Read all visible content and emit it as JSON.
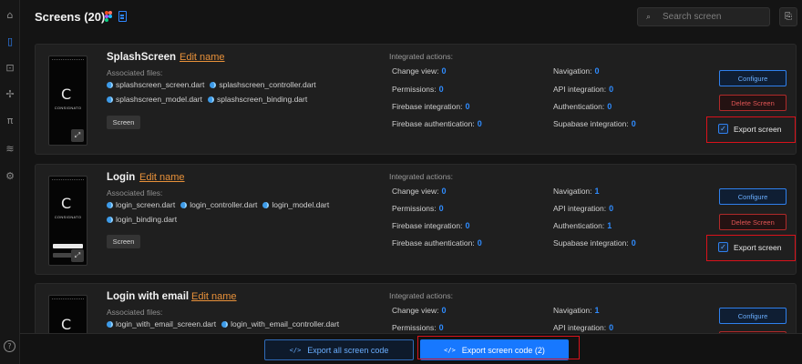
{
  "header": {
    "title": "Screens (20)",
    "search_placeholder": "Search screen"
  },
  "sidebar": {
    "items": [
      {
        "icon": "home-icon",
        "glyph": "⌂"
      },
      {
        "icon": "phone-icon",
        "glyph": "▯"
      },
      {
        "icon": "code-box-icon",
        "glyph": "⊡"
      },
      {
        "icon": "components-icon",
        "glyph": "✢"
      },
      {
        "icon": "pi-icon",
        "glyph": "π"
      },
      {
        "icon": "wifi-icon",
        "glyph": "≋"
      },
      {
        "icon": "settings-icon",
        "glyph": "⚙"
      },
      {
        "icon": "help-icon",
        "glyph": "?"
      }
    ]
  },
  "labels": {
    "edit_name": "Edit name",
    "associated_files": "Associated files:",
    "integrated_actions": "Integrated actions:",
    "screen_tag": "Screen",
    "configure": "Configure",
    "delete_screen": "Delete Screen",
    "export_screen": "Export screen",
    "thumb_brand": "CONSIGNATO"
  },
  "screens": [
    {
      "name": "SplashScreen",
      "files": [
        "splashscreen_screen.dart",
        "splashscreen_controller.dart",
        "splashscreen_model.dart",
        "splashscreen_binding.dart"
      ],
      "stats": {
        "change_view": {
          "label": "Change view:",
          "value": "0"
        },
        "permissions": {
          "label": "Permissions:",
          "value": "0"
        },
        "firebase_integration": {
          "label": "Firebase integration:",
          "value": "0"
        },
        "firebase_auth": {
          "label": "Firebase authentication:",
          "value": "0"
        },
        "navigation": {
          "label": "Navigation:",
          "value": "0"
        },
        "api_integration": {
          "label": "API integration:",
          "value": "0"
        },
        "authentication": {
          "label": "Authentication:",
          "value": "0"
        },
        "supabase_integration": {
          "label": "Supabase integration:",
          "value": "0"
        }
      },
      "export_checked": true
    },
    {
      "name": "Login",
      "files": [
        "login_screen.dart",
        "login_controller.dart",
        "login_model.dart",
        "login_binding.dart"
      ],
      "stats": {
        "change_view": {
          "label": "Change view:",
          "value": "0"
        },
        "permissions": {
          "label": "Permissions:",
          "value": "0"
        },
        "firebase_integration": {
          "label": "Firebase integration:",
          "value": "0"
        },
        "firebase_auth": {
          "label": "Firebase authentication:",
          "value": "0"
        },
        "navigation": {
          "label": "Navigation:",
          "value": "1"
        },
        "api_integration": {
          "label": "API integration:",
          "value": "0"
        },
        "authentication": {
          "label": "Authentication:",
          "value": "1"
        },
        "supabase_integration": {
          "label": "Supabase integration:",
          "value": "0"
        }
      },
      "export_checked": true
    },
    {
      "name": "Login with email",
      "files": [
        "login_with_email_screen.dart",
        "login_with_email_controller.dart"
      ],
      "stats": {
        "change_view": {
          "label": "Change view:",
          "value": "0"
        },
        "permissions": {
          "label": "Permissions:",
          "value": "0"
        },
        "navigation": {
          "label": "Navigation:",
          "value": "1"
        },
        "api_integration": {
          "label": "API integration:",
          "value": "0"
        }
      }
    }
  ],
  "footer": {
    "export_all": "Export all screen code",
    "export_selected": "Export screen code (2)"
  },
  "colors": {
    "accent": "#1778ff",
    "value_blue": "#2f8cff",
    "edit_orange": "#e8913a",
    "danger": "#e05555",
    "highlight_red": "#d9121b"
  }
}
